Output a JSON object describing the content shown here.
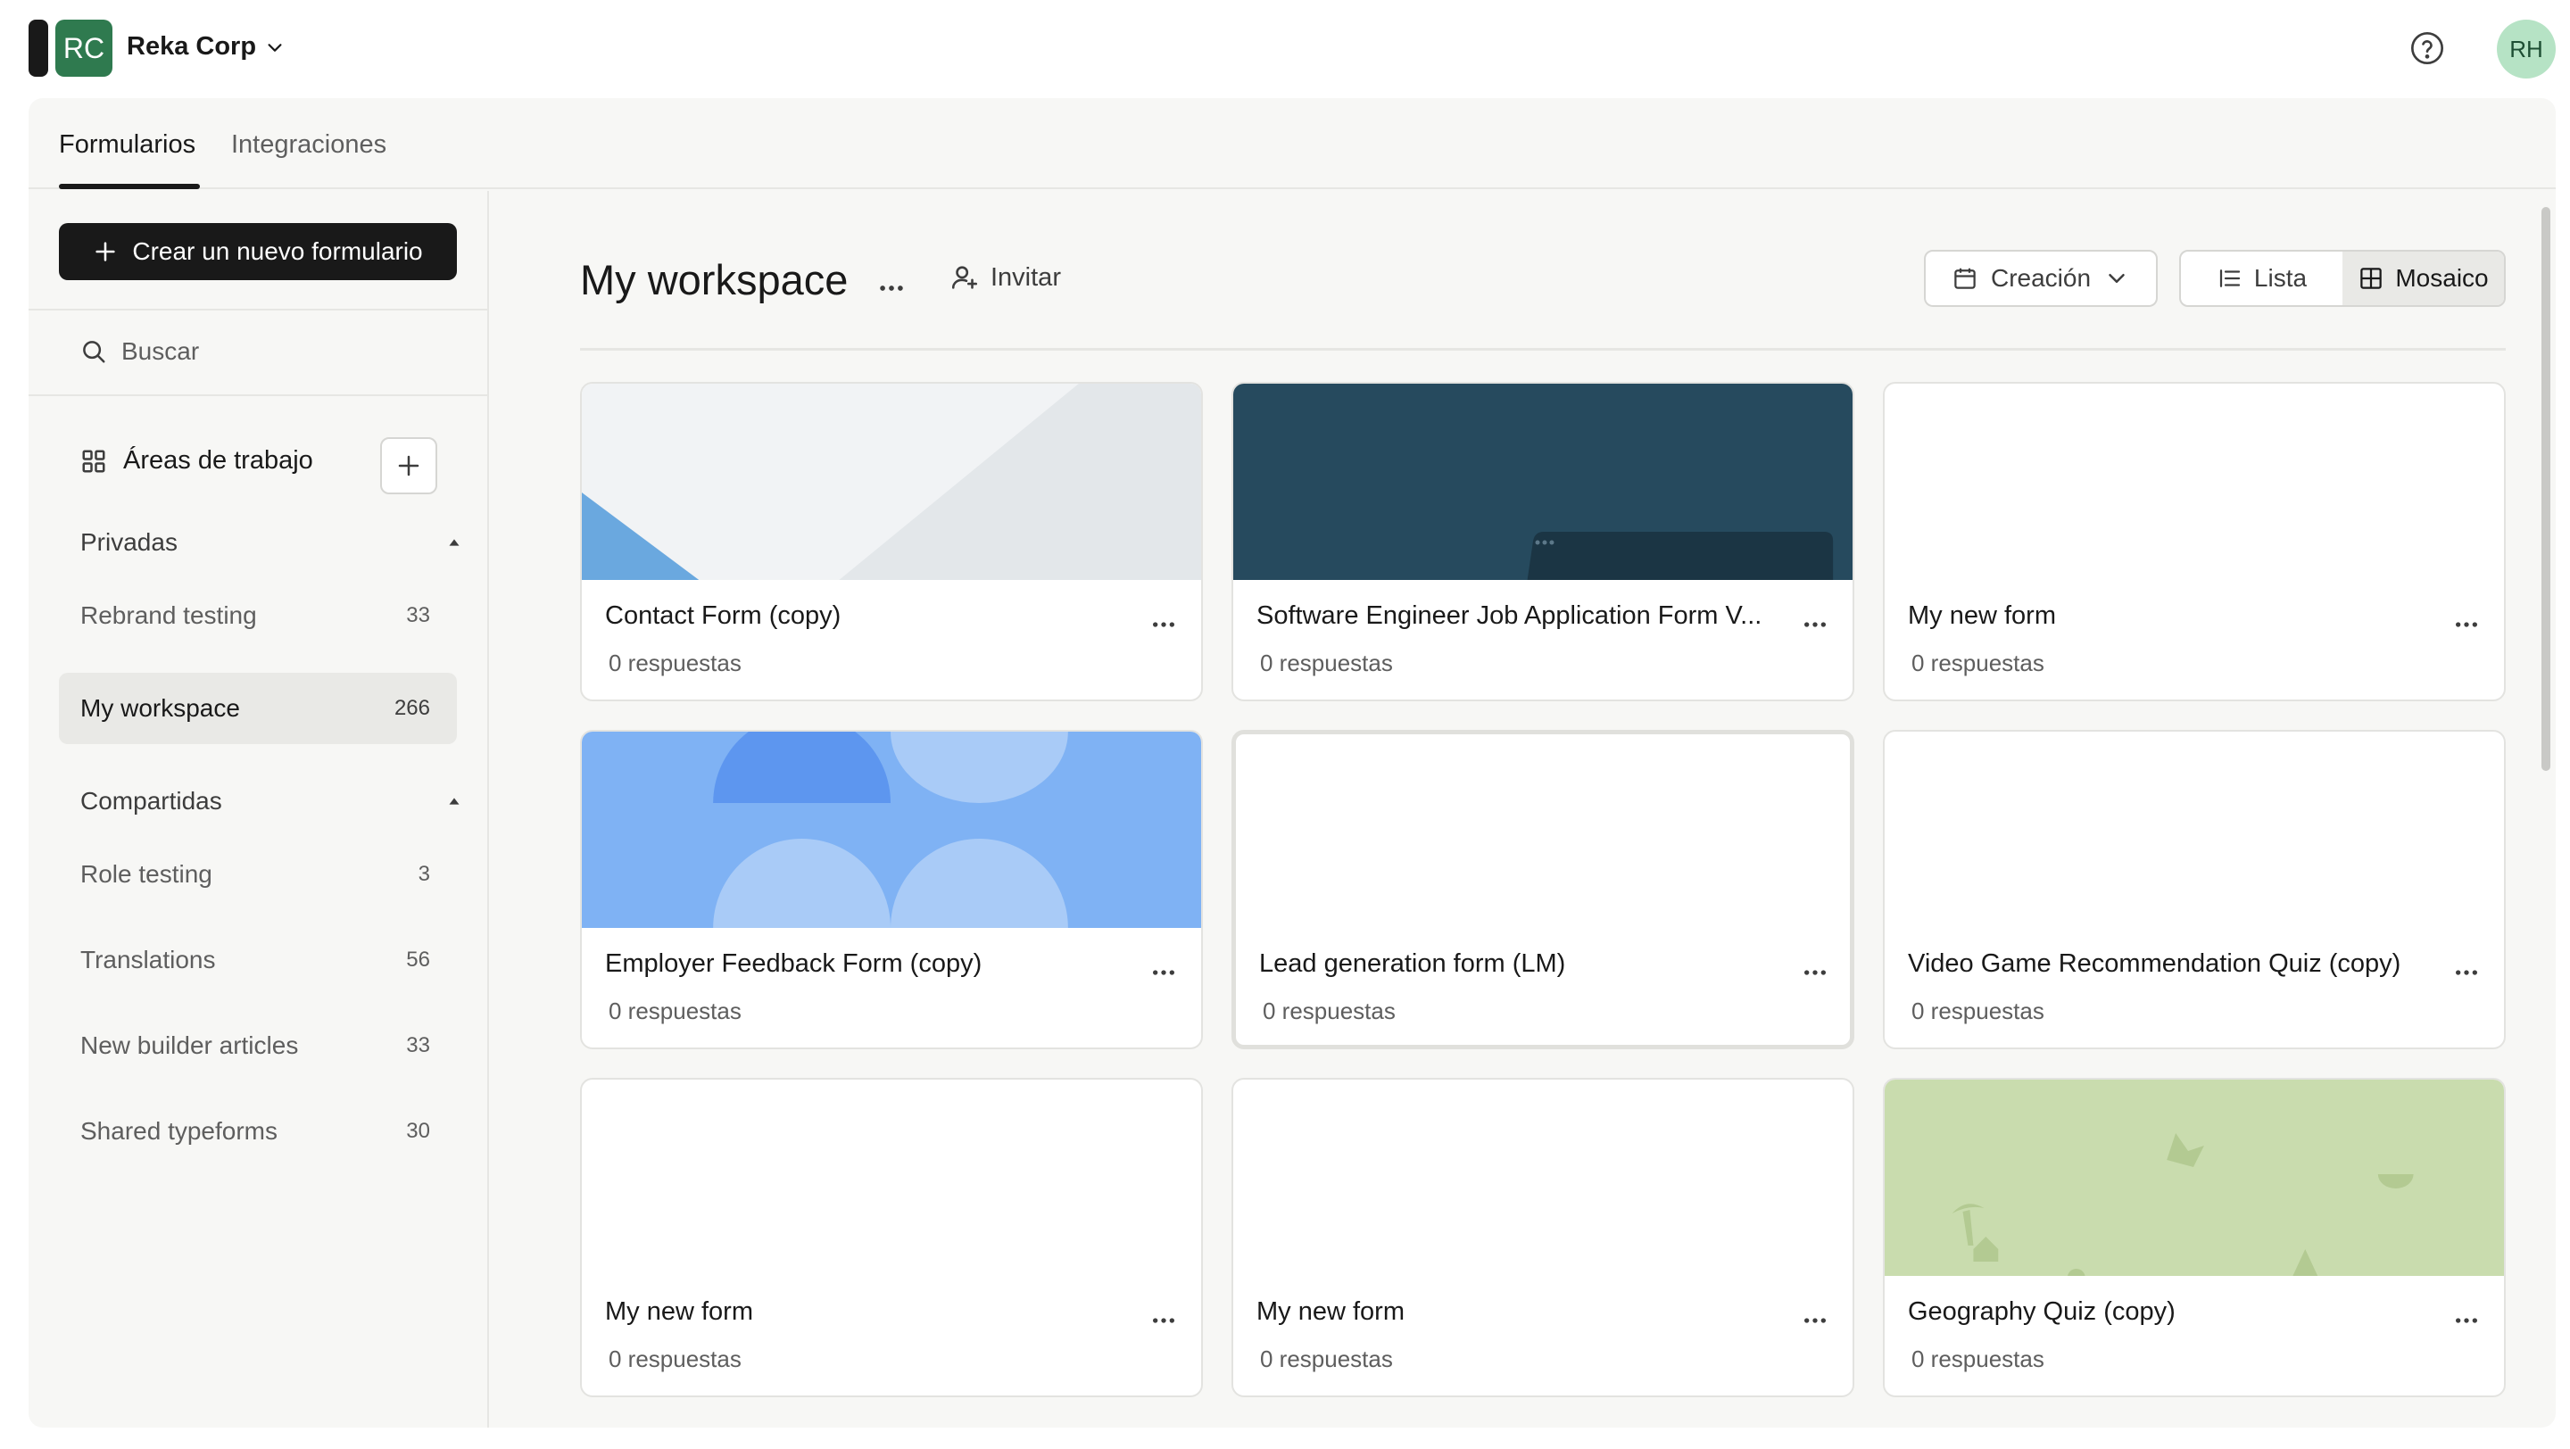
{
  "header": {
    "org_initials": "RC",
    "org_name": "Reka Corp",
    "user_initials": "RH"
  },
  "tabs": [
    {
      "label": "Formularios",
      "active": true
    },
    {
      "label": "Integraciones",
      "active": false
    }
  ],
  "sidebar": {
    "create_label": "Crear un nuevo formulario",
    "search_placeholder": "Buscar",
    "workspaces_label": "Áreas de trabajo",
    "private": {
      "label": "Privadas",
      "items": [
        {
          "label": "Rebrand testing",
          "count": "33",
          "active": false
        },
        {
          "label": "My workspace",
          "count": "266",
          "active": true
        }
      ]
    },
    "shared": {
      "label": "Compartidas",
      "items": [
        {
          "label": "Role testing",
          "count": "3"
        },
        {
          "label": "Translations",
          "count": "56"
        },
        {
          "label": "New builder articles",
          "count": "33"
        },
        {
          "label": "Shared typeforms",
          "count": "30"
        }
      ]
    }
  },
  "main": {
    "title": "My workspace",
    "invite_label": "Invitar",
    "sort_label": "Creación",
    "view": {
      "list_label": "Lista",
      "grid_label": "Mosaico",
      "active": "grid"
    },
    "forms": [
      {
        "title": "Contact Form (copy)",
        "responses": "0 respuestas",
        "thumb": "contact"
      },
      {
        "title": "Software Engineer Job Application Form V...",
        "responses": "0 respuestas",
        "thumb": "software"
      },
      {
        "title": "My new form",
        "responses": "0 respuestas",
        "thumb": "blank"
      },
      {
        "title": "Employer Feedback Form (copy)",
        "responses": "0 respuestas",
        "thumb": "employer"
      },
      {
        "title": "Lead generation form (LM)",
        "responses": "0 respuestas",
        "thumb": "blank"
      },
      {
        "title": "Video Game Recommendation Quiz (copy)",
        "responses": "0 respuestas",
        "thumb": "blank"
      },
      {
        "title": "My new form",
        "responses": "0 respuestas",
        "thumb": "blank"
      },
      {
        "title": "My new form",
        "responses": "0 respuestas",
        "thumb": "blank"
      },
      {
        "title": "Geography Quiz (copy)",
        "responses": "0 respuestas",
        "thumb": "geography"
      }
    ]
  },
  "colors": {
    "accent": "#191919",
    "org_avatar": "#2f7a4f",
    "user_avatar": "#b6e3c5",
    "software_thumb": "#264a5e",
    "employer_thumb": "#7fb2f4",
    "geography_thumb": "#c9dcae"
  }
}
